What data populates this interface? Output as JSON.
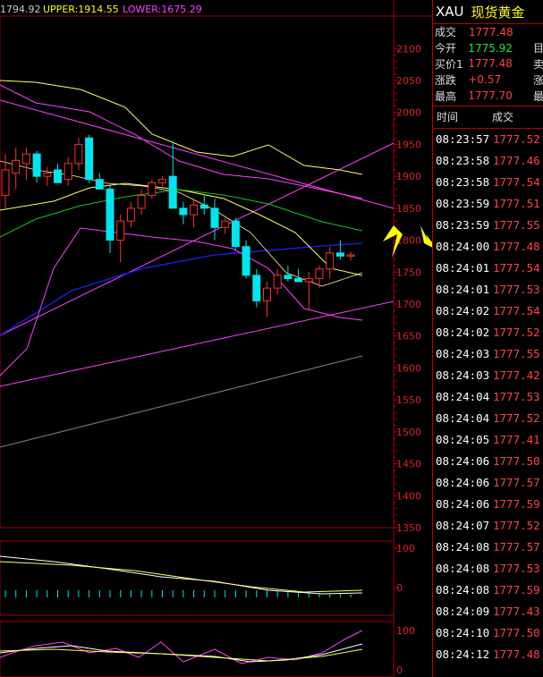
{
  "chart_header": {
    "mid_text": "1794.92",
    "upper_text": "UPPER:1914.55",
    "lower_text": "LOWER:1675.29"
  },
  "price_axis": [
    "2100",
    "2050",
    "2000",
    "1950",
    "1900",
    "1850",
    "1800",
    "1750",
    "1700",
    "1650",
    "1600",
    "1550",
    "1500",
    "1450",
    "1400",
    "1350"
  ],
  "sub1_axis": [
    "100",
    "0"
  ],
  "sub2_axis": [
    "100",
    "0"
  ],
  "colors": {
    "up": "#ff3030",
    "down": "#00e5ee",
    "grid": "#a00000",
    "axis_text": "#d22",
    "upper": "#ff40ff",
    "mid": "#2020ff",
    "ma_yellow": "#ffff60"
  },
  "panel": {
    "code": "XAU",
    "name": "现货黄金",
    "quotes": [
      {
        "label": "成交",
        "value": "1777.48",
        "color": "#ff4040",
        "extra": ""
      },
      {
        "label": "今开",
        "value": "1775.92",
        "color": "#30e030",
        "extra": "目"
      },
      {
        "label": "买价1",
        "value": "1777.48",
        "color": "#ff4040",
        "extra": "卖"
      },
      {
        "label": "涨跌",
        "value": "+0.57",
        "color": "#ff4040",
        "extra": "涨"
      },
      {
        "label": "最高",
        "value": "1777.70",
        "color": "#ff4040",
        "extra": "最"
      }
    ],
    "tick_header": {
      "time": "时间",
      "price": "成交"
    },
    "ticks": [
      {
        "time": "08:23:57",
        "price": "1777.52"
      },
      {
        "time": "08:23:58",
        "price": "1777.46"
      },
      {
        "time": "08:23:58",
        "price": "1777.54"
      },
      {
        "time": "08:23:59",
        "price": "1777.51"
      },
      {
        "time": "08:23:59",
        "price": "1777.55"
      },
      {
        "time": "08:24:00",
        "price": "1777.48"
      },
      {
        "time": "08:24:01",
        "price": "1777.54"
      },
      {
        "time": "08:24:01",
        "price": "1777.53"
      },
      {
        "time": "08:24:02",
        "price": "1777.54"
      },
      {
        "time": "08:24:02",
        "price": "1777.52"
      },
      {
        "time": "08:24:03",
        "price": "1777.55"
      },
      {
        "time": "08:24:03",
        "price": "1777.42"
      },
      {
        "time": "08:24:04",
        "price": "1777.53"
      },
      {
        "time": "08:24:04",
        "price": "1777.52"
      },
      {
        "time": "08:24:05",
        "price": "1777.41"
      },
      {
        "time": "08:24:06",
        "price": "1777.50"
      },
      {
        "time": "08:24:06",
        "price": "1777.57"
      },
      {
        "time": "08:24:06",
        "price": "1777.59"
      },
      {
        "time": "08:24:07",
        "price": "1777.52"
      },
      {
        "time": "08:24:08",
        "price": "1777.57"
      },
      {
        "time": "08:24:08",
        "price": "1777.53"
      },
      {
        "time": "08:24:08",
        "price": "1777.59"
      },
      {
        "time": "08:24:09",
        "price": "1777.43"
      },
      {
        "time": "08:24:10",
        "price": "1777.50"
      },
      {
        "time": "08:24:12",
        "price": "1777.48"
      }
    ]
  },
  "chart_data": {
    "type": "candlestick",
    "y_range": [
      1350,
      2120
    ],
    "candles": [
      {
        "o": 1870,
        "h": 1935,
        "l": 1850,
        "c": 1910
      },
      {
        "o": 1905,
        "h": 1945,
        "l": 1880,
        "c": 1925
      },
      {
        "o": 1920,
        "h": 1945,
        "l": 1895,
        "c": 1935
      },
      {
        "o": 1935,
        "h": 1940,
        "l": 1890,
        "c": 1900
      },
      {
        "o": 1900,
        "h": 1915,
        "l": 1885,
        "c": 1905
      },
      {
        "o": 1910,
        "h": 1920,
        "l": 1895,
        "c": 1890
      },
      {
        "o": 1895,
        "h": 1930,
        "l": 1885,
        "c": 1920
      },
      {
        "o": 1920,
        "h": 1960,
        "l": 1910,
        "c": 1950
      },
      {
        "o": 1960,
        "h": 1965,
        "l": 1890,
        "c": 1895
      },
      {
        "o": 1895,
        "h": 1905,
        "l": 1880,
        "c": 1880
      },
      {
        "o": 1880,
        "h": 1885,
        "l": 1780,
        "c": 1800
      },
      {
        "o": 1800,
        "h": 1840,
        "l": 1765,
        "c": 1830
      },
      {
        "o": 1830,
        "h": 1860,
        "l": 1820,
        "c": 1850
      },
      {
        "o": 1850,
        "h": 1880,
        "l": 1840,
        "c": 1870
      },
      {
        "o": 1870,
        "h": 1895,
        "l": 1865,
        "c": 1890
      },
      {
        "o": 1890,
        "h": 1900,
        "l": 1885,
        "c": 1895
      },
      {
        "o": 1900,
        "h": 1955,
        "l": 1850,
        "c": 1850
      },
      {
        "o": 1850,
        "h": 1860,
        "l": 1825,
        "c": 1840
      },
      {
        "o": 1840,
        "h": 1865,
        "l": 1820,
        "c": 1855
      },
      {
        "o": 1855,
        "h": 1870,
        "l": 1840,
        "c": 1850
      },
      {
        "o": 1850,
        "h": 1865,
        "l": 1800,
        "c": 1820
      },
      {
        "o": 1820,
        "h": 1835,
        "l": 1810,
        "c": 1830
      },
      {
        "o": 1830,
        "h": 1835,
        "l": 1785,
        "c": 1790
      },
      {
        "o": 1790,
        "h": 1800,
        "l": 1740,
        "c": 1745
      },
      {
        "o": 1745,
        "h": 1755,
        "l": 1695,
        "c": 1705
      },
      {
        "o": 1705,
        "h": 1735,
        "l": 1680,
        "c": 1725
      },
      {
        "o": 1725,
        "h": 1755,
        "l": 1715,
        "c": 1745
      },
      {
        "o": 1745,
        "h": 1760,
        "l": 1735,
        "c": 1740
      },
      {
        "o": 1740,
        "h": 1755,
        "l": 1735,
        "c": 1735
      },
      {
        "o": 1735,
        "h": 1750,
        "l": 1690,
        "c": 1740
      },
      {
        "o": 1740,
        "h": 1760,
        "l": 1725,
        "c": 1755
      },
      {
        "o": 1755,
        "h": 1790,
        "l": 1740,
        "c": 1780
      },
      {
        "o": 1780,
        "h": 1800,
        "l": 1770,
        "c": 1775
      },
      {
        "o": 1775,
        "h": 1782,
        "l": 1768,
        "c": 1777
      }
    ]
  }
}
